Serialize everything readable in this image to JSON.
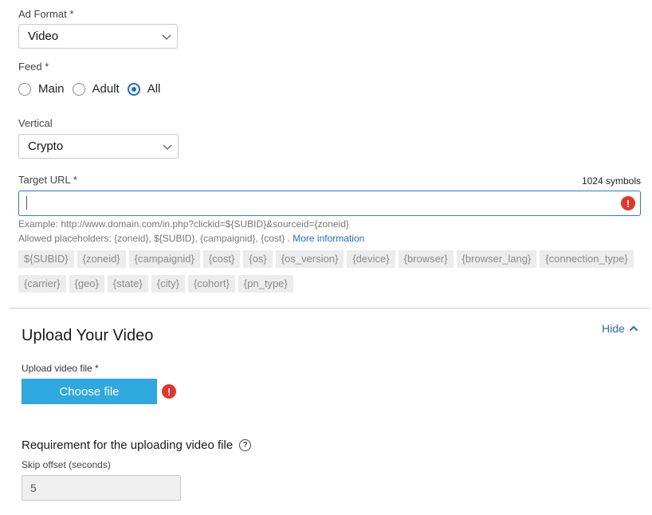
{
  "ad_format": {
    "label": "Ad Format",
    "required_mark": "*",
    "value": "Video"
  },
  "feed": {
    "label": "Feed",
    "required_mark": "*",
    "options": [
      {
        "label": "Main",
        "checked": false
      },
      {
        "label": "Adult",
        "checked": false
      },
      {
        "label": "All",
        "checked": true
      }
    ]
  },
  "vertical": {
    "label": "Vertical",
    "value": "Crypto"
  },
  "target_url": {
    "label": "Target URL",
    "required_mark": "*",
    "counter": "1024 symbols",
    "value": "",
    "error_mark": "!",
    "example": "Example: http://www.domain.com/in.php?clickid=${SUBID}&sourceid={zoneid}",
    "allowed": "Allowed placeholders: {zoneid}, ${SUBID}, {campaignid}, {cost} .",
    "more_info": "More information",
    "placeholders": [
      "${SUBID}",
      "{zoneid}",
      "{campaignid}",
      "{cost}",
      "{os}",
      "{os_version}",
      "{device}",
      "{browser}",
      "{browser_lang}",
      "{connection_type}",
      "{carrier}",
      "{geo}",
      "{state}",
      "{city}",
      "{cohort}",
      "{pn_type}"
    ]
  },
  "upload": {
    "title": "Upload Your Video",
    "hide_label": "Hide",
    "file_label": "Upload video file *",
    "choose_button": "Choose file",
    "error_mark": "!",
    "requirement_title": "Requirement for the uploading video file",
    "help_mark": "?",
    "skip_label": "Skip offset (seconds)",
    "skip_value": "5"
  },
  "colors": {
    "accent": "#1e6fd0",
    "button": "#2fa8e0",
    "error": "#e8352c"
  }
}
